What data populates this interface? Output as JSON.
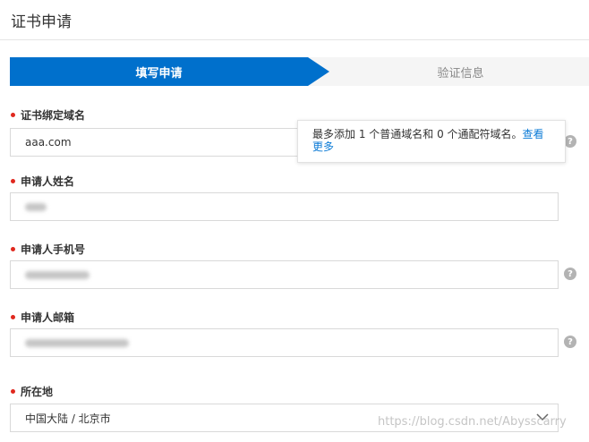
{
  "page": {
    "title": "证书申请"
  },
  "steps": {
    "active": "填写申请",
    "next": "验证信息"
  },
  "fields": {
    "domain": {
      "label": "证书绑定域名",
      "value": "aaa.com"
    },
    "name": {
      "label": "申请人姓名"
    },
    "phone": {
      "label": "申请人手机号"
    },
    "email": {
      "label": "申请人邮箱"
    },
    "location": {
      "label": "所在地",
      "value": "中国大陆 / 北京市"
    }
  },
  "tooltip": {
    "text": "最多添加 1 个普通域名和 0 个通配符域名。",
    "link": "查看更多"
  },
  "help": {
    "glyph": "?"
  },
  "watermark": "https://blog.csdn.net/Abysscarry",
  "colors": {
    "accent": "#0070cc",
    "required": "#e0281e",
    "link": "#0a7ad6"
  }
}
